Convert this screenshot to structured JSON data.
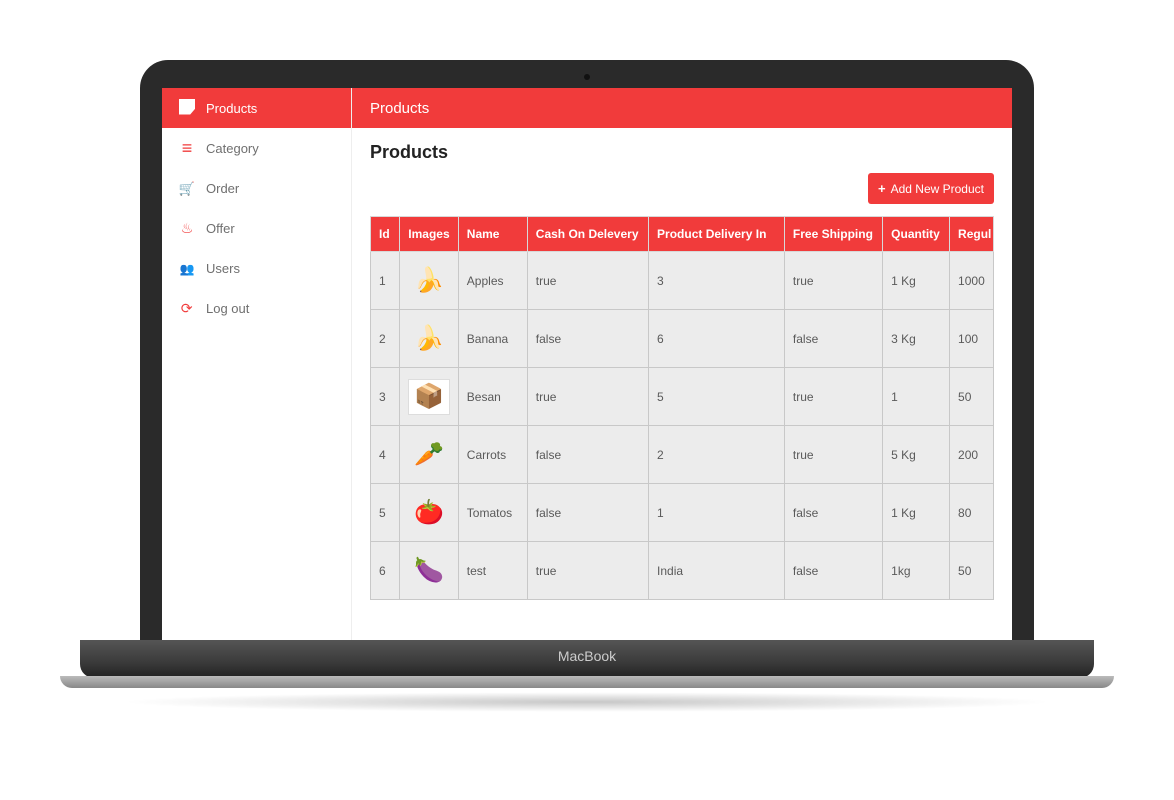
{
  "sidebar": {
    "items": [
      {
        "label": "Products",
        "icon": "logo",
        "active": true
      },
      {
        "label": "Category",
        "icon": "menu",
        "active": false
      },
      {
        "label": "Order",
        "icon": "cart",
        "active": false
      },
      {
        "label": "Offer",
        "icon": "fire",
        "active": false
      },
      {
        "label": "Users",
        "icon": "users",
        "active": false
      },
      {
        "label": "Log out",
        "icon": "logout",
        "active": false
      }
    ]
  },
  "header": {
    "title": "Products"
  },
  "page": {
    "title": "Products"
  },
  "buttons": {
    "add_product": "Add New Product"
  },
  "table": {
    "headers": [
      "Id",
      "Images",
      "Name",
      "Cash On Delevery",
      "Product Delivery In",
      "Free Shipping",
      "Quantity",
      "Regul"
    ],
    "rows": [
      {
        "id": "1",
        "image": "banana",
        "boxed": false,
        "name": "Apples",
        "cod": "true",
        "delivery": "3",
        "ship": "true",
        "qty": "1 Kg",
        "reg": "1000"
      },
      {
        "id": "2",
        "image": "banana",
        "boxed": false,
        "name": "Banana",
        "cod": "false",
        "delivery": "6",
        "ship": "false",
        "qty": "3 Kg",
        "reg": "100"
      },
      {
        "id": "3",
        "image": "package",
        "boxed": true,
        "name": "Besan",
        "cod": "true",
        "delivery": "5",
        "ship": "true",
        "qty": "1",
        "reg": "50"
      },
      {
        "id": "4",
        "image": "carrot",
        "boxed": false,
        "name": "Carrots",
        "cod": "false",
        "delivery": "2",
        "ship": "true",
        "qty": "5 Kg",
        "reg": "200"
      },
      {
        "id": "5",
        "image": "tomato",
        "boxed": false,
        "name": "Tomatos",
        "cod": "false",
        "delivery": "1",
        "ship": "false",
        "qty": "1 Kg",
        "reg": "80"
      },
      {
        "id": "6",
        "image": "eggplant",
        "boxed": false,
        "name": "test",
        "cod": "true",
        "delivery": "India",
        "ship": "false",
        "qty": "1kg",
        "reg": "50"
      }
    ]
  },
  "device": {
    "label": "MacBook"
  },
  "icon_glyphs": {
    "banana": "🍌",
    "package": "📦",
    "carrot": "🥕",
    "tomato": "🍅",
    "eggplant": "🍆"
  }
}
